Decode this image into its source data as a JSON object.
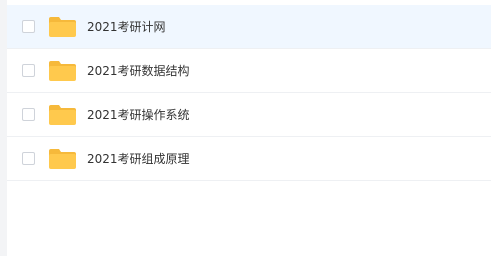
{
  "file_list": {
    "items": [
      {
        "name": "2021考研计网",
        "selected": true
      },
      {
        "name": "2021考研数据结构",
        "selected": false
      },
      {
        "name": "2021考研操作系统",
        "selected": false
      },
      {
        "name": "2021考研组成原理",
        "selected": false
      }
    ]
  },
  "colors": {
    "folder_body": "#ffc94d",
    "folder_tab": "#f6b93b",
    "selected_row": "#f0f7ff",
    "text": "#333333"
  },
  "icons": {
    "row_icon": "folder-icon",
    "row_select": "checkbox-icon"
  }
}
